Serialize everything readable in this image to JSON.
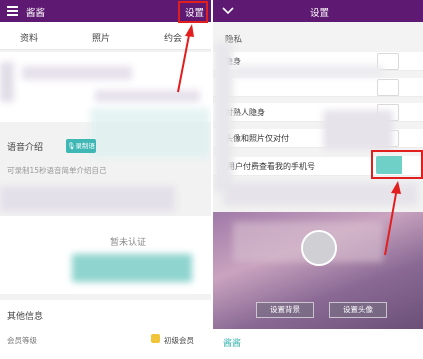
{
  "left": {
    "header": {
      "title": "酱酱",
      "settings_label": "设置"
    },
    "tabs": [
      {
        "label": "资料"
      },
      {
        "label": "照片"
      },
      {
        "label": "约会"
      }
    ],
    "voice": {
      "title": "语音介绍",
      "record_label": "录制语",
      "hint": "可录制15秒语音简单介绍自己"
    },
    "verify": {
      "status": "暂未认证"
    },
    "other": {
      "title": "其他信息",
      "level_label": "会员等级",
      "level_value": "初级会员"
    }
  },
  "right": {
    "header": {
      "title": "设置"
    },
    "privacy": {
      "title": "隐私",
      "items": [
        {
          "label": "隐身",
          "on": false
        },
        {
          "label": "",
          "on": false
        },
        {
          "label": "对熟人隐身",
          "on": false
        },
        {
          "label": "头像和照片仅对付",
          "on": false
        },
        {
          "label": "用户付费查看我的手机号",
          "on": true
        }
      ]
    },
    "profile": {
      "name": "酱酱",
      "set_background": "设置背景",
      "set_avatar": "设置头像"
    }
  },
  "colors": {
    "header": "#5e1a72",
    "accent": "#3fb7b4",
    "annotation": "#e21f1f",
    "name": "#3fb7b4"
  }
}
